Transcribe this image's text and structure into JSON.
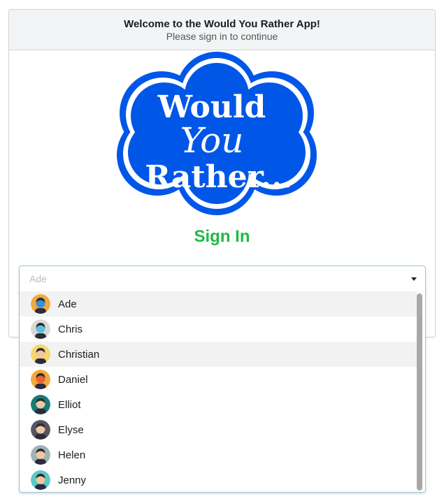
{
  "header": {
    "title": "Welcome to the Would You Rather App!",
    "subtitle": "Please sign in to continue"
  },
  "logo": {
    "line1": "Would",
    "line2": "You",
    "line3": "Rather...",
    "color": "#0057e7"
  },
  "signin": {
    "title": "Sign In",
    "color": "#21ba45"
  },
  "select": {
    "placeholder": "Ade"
  },
  "users": [
    {
      "name": "Ade",
      "avatar_bg": "#f2a93b",
      "avatar_face": "#3a8fd6"
    },
    {
      "name": "Chris",
      "avatar_bg": "#d9d9d9",
      "avatar_face": "#5bc0de"
    },
    {
      "name": "Christian",
      "avatar_bg": "#f5d76e",
      "avatar_face": "#f0c8a0"
    },
    {
      "name": "Daniel",
      "avatar_bg": "#f2a93b",
      "avatar_face": "#e8603c"
    },
    {
      "name": "Elliot",
      "avatar_bg": "#1a7a7a",
      "avatar_face": "#f0c8a0"
    },
    {
      "name": "Elyse",
      "avatar_bg": "#555566",
      "avatar_face": "#f0c8a0"
    },
    {
      "name": "Helen",
      "avatar_bg": "#9fb3b8",
      "avatar_face": "#f0c8a0"
    },
    {
      "name": "Jenny",
      "avatar_bg": "#5bc8c8",
      "avatar_face": "#f0c8a0"
    }
  ]
}
